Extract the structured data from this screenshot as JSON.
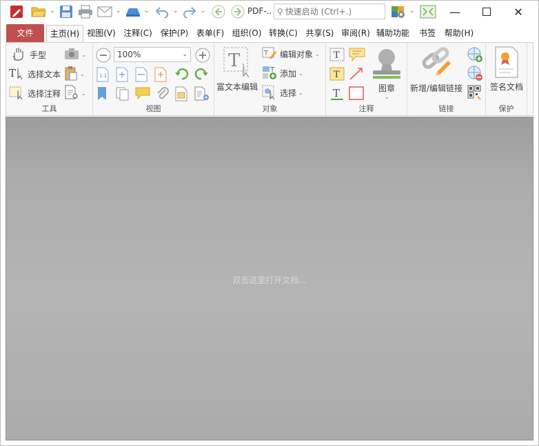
{
  "app": {
    "quick_access": {
      "pdf_label": "PDF-..",
      "search_placeholder": "快速启动 (Ctrl+.)"
    }
  },
  "tabs": [
    {
      "label": "文件"
    },
    {
      "label": "主页(H)"
    },
    {
      "label": "视图(V)"
    },
    {
      "label": "注释(C)"
    },
    {
      "label": "保护(P)"
    },
    {
      "label": "表单(F)"
    },
    {
      "label": "组织(O)"
    },
    {
      "label": "转换(C)"
    },
    {
      "label": "共享(S)"
    },
    {
      "label": "审阅(R)"
    },
    {
      "label": "辅助功能"
    },
    {
      "label": "书签"
    },
    {
      "label": "帮助(H)"
    }
  ],
  "ribbon": {
    "tools": {
      "hand": "手型",
      "select_text": "选择文本",
      "select_annotation": "选择注释",
      "label": "工具"
    },
    "view": {
      "zoom": "100%",
      "label": "视图"
    },
    "objects": {
      "rich_text": "富文本编辑",
      "edit_objects": "编辑对象",
      "add": "添加",
      "select": "选择",
      "label": "对象"
    },
    "annotation": {
      "stamp": "图章",
      "label": "注释"
    },
    "links": {
      "add_edit_link": "新增/编辑链接",
      "label": "链接"
    },
    "protect": {
      "sign": "签名文档",
      "label": "保护"
    }
  },
  "document": {
    "hint": "双击这里打开文档..."
  },
  "colors": {
    "file_tab": "#c0504d",
    "accent_orange": "#f0a030",
    "accent_green": "#5aa53c",
    "accent_blue": "#3b7dc4"
  }
}
